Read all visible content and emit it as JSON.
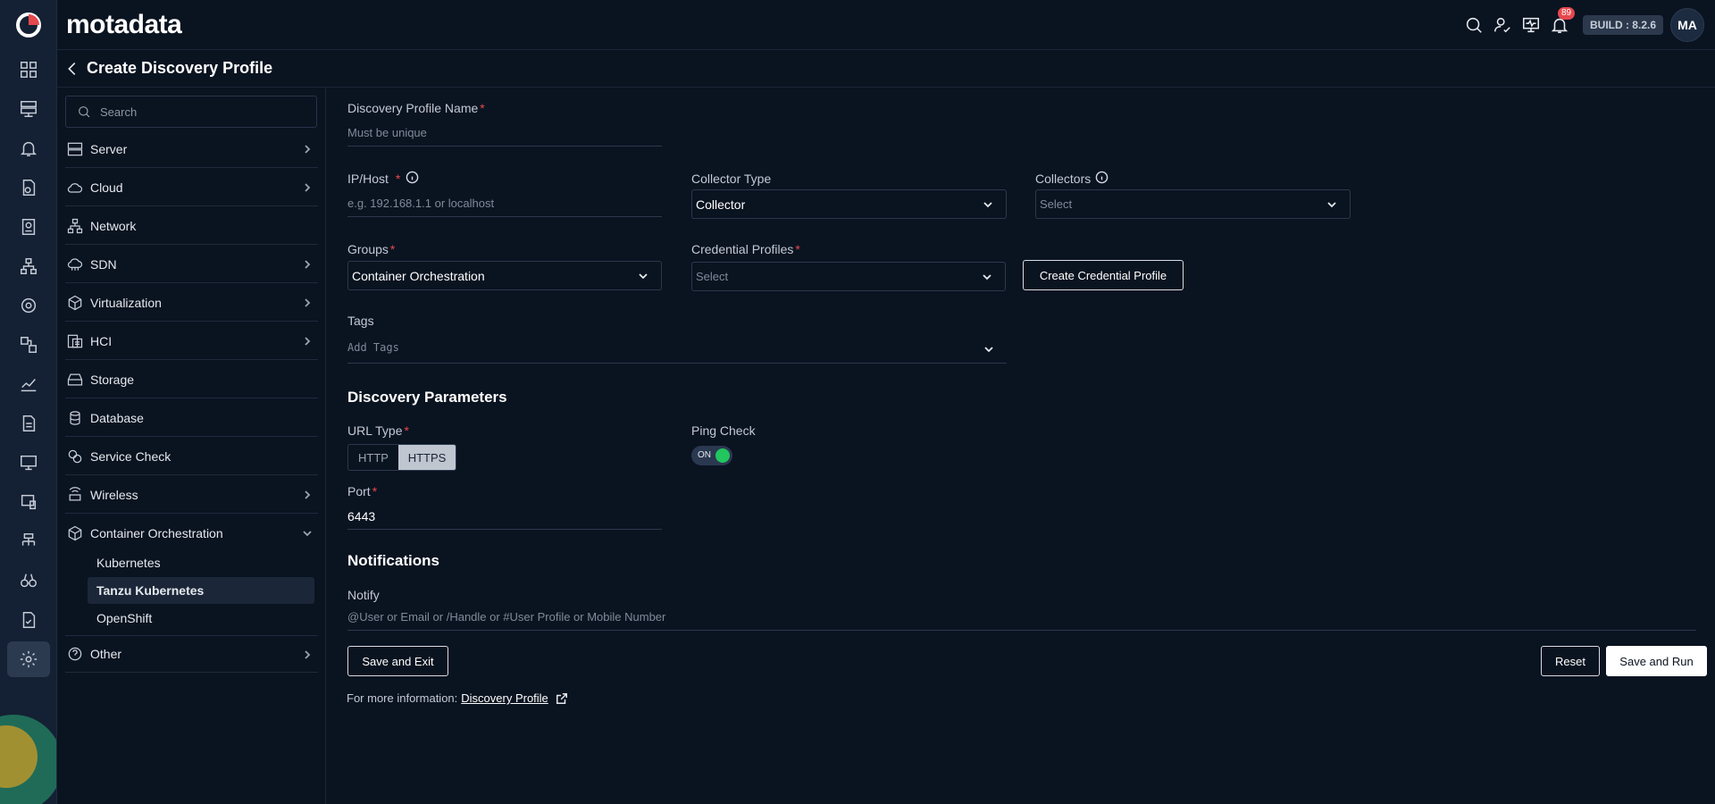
{
  "brand": "motadata",
  "topbar": {
    "notification_count": "89",
    "build": "BUILD : 8.2.6",
    "avatar_initials": "MA"
  },
  "page": {
    "title": "Create Discovery Profile"
  },
  "catalog": {
    "search_placeholder": "Search",
    "categories": [
      {
        "label": "Server",
        "icon": "server-icon",
        "has_children": true
      },
      {
        "label": "Cloud",
        "icon": "cloud-icon",
        "has_children": true
      },
      {
        "label": "Network",
        "icon": "network-icon",
        "has_children": false
      },
      {
        "label": "SDN",
        "icon": "sdn-icon",
        "has_children": true
      },
      {
        "label": "Virtualization",
        "icon": "cube-icon",
        "has_children": true
      },
      {
        "label": "HCI",
        "icon": "hci-icon",
        "has_children": true
      },
      {
        "label": "Storage",
        "icon": "storage-icon",
        "has_children": false
      },
      {
        "label": "Database",
        "icon": "database-icon",
        "has_children": false
      },
      {
        "label": "Service Check",
        "icon": "service-check-icon",
        "has_children": false
      },
      {
        "label": "Wireless",
        "icon": "wireless-icon",
        "has_children": true
      },
      {
        "label": "Container Orchestration",
        "icon": "container-icon",
        "expanded": true
      },
      {
        "label": "Other",
        "icon": "question-circle-icon",
        "has_children": true
      }
    ],
    "container_children": [
      "Kubernetes",
      "Tanzu Kubernetes",
      "OpenShift"
    ],
    "selected_child": "Tanzu Kubernetes"
  },
  "form": {
    "profile_name": {
      "label": "Discovery Profile Name",
      "placeholder": "Must be unique",
      "value": ""
    },
    "ip_host": {
      "label": "IP/Host",
      "placeholder": "e.g. 192.168.1.1 or localhost",
      "value": ""
    },
    "collector_type": {
      "label": "Collector Type",
      "value": "Collector"
    },
    "collectors": {
      "label": "Collectors",
      "placeholder": "Select"
    },
    "groups": {
      "label": "Groups",
      "value": "Container Orchestration"
    },
    "credential_profiles": {
      "label": "Credential Profiles",
      "placeholder": "Select"
    },
    "create_credential_label": "Create Credential Profile",
    "tags": {
      "label": "Tags",
      "placeholder": "Add Tags"
    },
    "discovery_parameters_title": "Discovery Parameters",
    "url_type": {
      "label": "URL Type",
      "options": [
        "HTTP",
        "HTTPS"
      ],
      "selected": "HTTPS"
    },
    "ping_check": {
      "label": "Ping Check",
      "state_label": "ON",
      "on": true
    },
    "port": {
      "label": "Port",
      "value": "6443"
    },
    "notifications_title": "Notifications",
    "notify": {
      "label": "Notify",
      "placeholder": "@User or Email or /Handle or #User Profile or Mobile Number"
    },
    "save_exit_label": "Save and Exit",
    "reset_label": "Reset",
    "save_run_label": "Save and Run",
    "more_info_prefix": "For more information:",
    "more_info_link": "Discovery Profile"
  },
  "colors": {
    "background": "#0a1320",
    "rail": "#142033",
    "required": "#e5484d",
    "toggle_on": "#22c55e",
    "badge": "#e5484d"
  }
}
